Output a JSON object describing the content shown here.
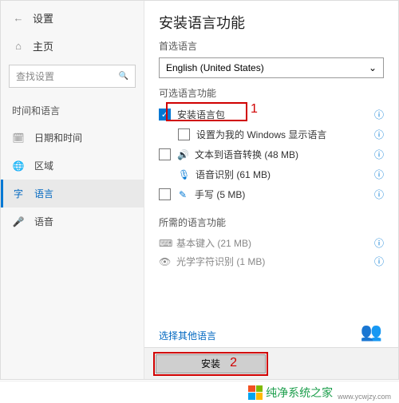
{
  "sidebar": {
    "back_icon": "←",
    "settings": "设置",
    "home_icon": "⌂",
    "home": "主页",
    "search_placeholder": "查找设置",
    "search_icon": "🔍",
    "group": "时间和语言",
    "items": [
      {
        "icon": "🗓",
        "label": "日期和时间"
      },
      {
        "icon": "🌐",
        "label": "区域"
      },
      {
        "icon": "字",
        "label": "语言"
      },
      {
        "icon": "🎤",
        "label": "语音"
      }
    ]
  },
  "panel": {
    "title": "安装语言功能",
    "pref_lang": "首选语言",
    "selected_lang": "English (United States)",
    "optional_head": "可选语言功能",
    "opts": [
      {
        "label": "安装语言包",
        "checked": true,
        "info": true
      },
      {
        "label": "设置为我的 Windows 显示语言",
        "checked": false,
        "sub": true,
        "info": true
      },
      {
        "label": "文本到语音转换 (48 MB)",
        "checked": false,
        "icon": "🔊",
        "info": true
      },
      {
        "label": "语音识别 (61 MB)",
        "sub": true,
        "icon": "🎙",
        "info": true
      },
      {
        "label": "手写 (5 MB)",
        "checked": false,
        "icon": "✎",
        "info": true
      }
    ],
    "required_head": "所需的语言功能",
    "required": [
      {
        "icon": "⌨",
        "label": "基本键入 (21 MB)",
        "info": true
      },
      {
        "icon": "👁",
        "label": "光学字符识别 (1 MB)",
        "info": true
      }
    ],
    "other_lang": "选择其他语言",
    "install_btn": "安装",
    "annot1": "1",
    "annot2": "2"
  },
  "watermark": {
    "text": "纯净系统之家",
    "url": "www.ycwjzy.com"
  }
}
